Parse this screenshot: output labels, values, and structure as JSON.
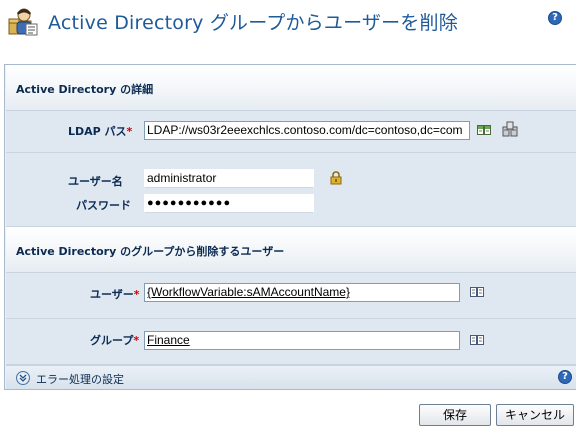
{
  "header": {
    "title": "Active Directory グループからユーザーを削除",
    "help": "?"
  },
  "section1": {
    "title": "Active Directory の詳細",
    "ldap_label": "LDAP パス",
    "ldap_value": "LDAP://ws03r2eeexchlcs.contoso.com/dc=contoso,dc=com",
    "username_label": "ユーザー名",
    "username_value": "administrator",
    "password_label": "パスワード",
    "password_value": "●●●●●●●●●●●"
  },
  "section2": {
    "title": "Active Directory のグループから削除するユーザー",
    "user_label": "ユーザー",
    "user_value": "{WorkflowVariable:sAMAccountName}",
    "group_label": "グループ",
    "group_value": "Finance"
  },
  "required_mark": "*",
  "error_settings": {
    "label": "エラー処理の設定",
    "help": "?"
  },
  "buttons": {
    "save": "保存",
    "cancel": "キャンセル"
  },
  "colors": {
    "title": "#1f5a99",
    "label": "#0c2b51",
    "band": "#dfe7f1",
    "required": "#d00000"
  }
}
